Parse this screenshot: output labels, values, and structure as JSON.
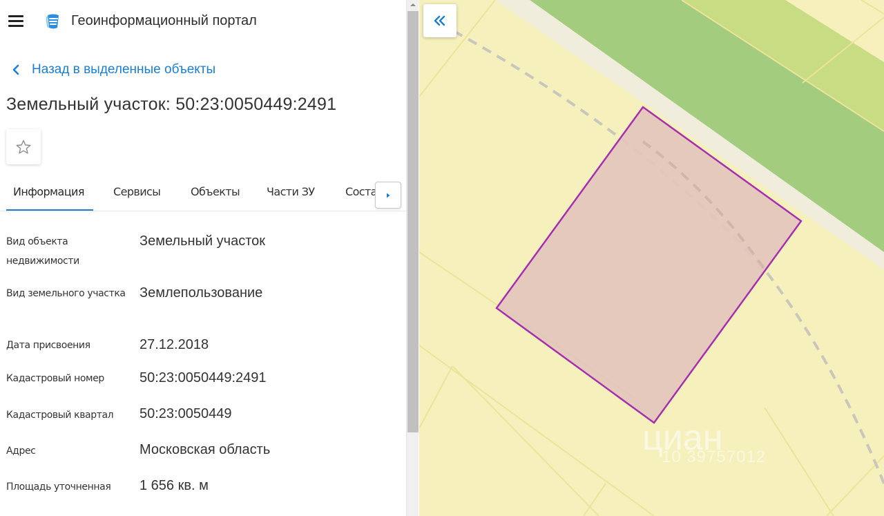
{
  "header": {
    "menu_icon": "hamburger-menu-icon",
    "logo_icon": "portal-logo-icon",
    "title": "Геоинформационный портал"
  },
  "navigation": {
    "back_label": "Назад в выделенные объекты",
    "back_icon": "chevron-left-icon"
  },
  "object": {
    "title": "Земельный участок: 50:23:0050449:2491",
    "favorite_icon": "star-outline-icon"
  },
  "tabs": [
    {
      "label": "Информация",
      "active": true
    },
    {
      "label": "Сервисы",
      "active": false
    },
    {
      "label": "Объекты",
      "active": false
    },
    {
      "label": "Части ЗУ",
      "active": false
    },
    {
      "label": "Состав ЕЗ",
      "active": false
    }
  ],
  "tabs_scroll_icon": "caret-right-icon",
  "properties": [
    {
      "label": "Вид объекта недвижимости",
      "value": "Земельный участок"
    },
    {
      "label": "Вид земельного участка",
      "value": "Землепользование"
    },
    {
      "label": "Дата присвоения",
      "value": "27.12.2018"
    },
    {
      "label": "Кадастровый номер",
      "value": "50:23:0050449:2491"
    },
    {
      "label": "Кадастровый квартал",
      "value": "50:23:0050449"
    },
    {
      "label": "Адрес",
      "value": "Московская область"
    },
    {
      "label": "Площадь уточненная",
      "value": "1 656 кв. м"
    }
  ],
  "map": {
    "collapse_icon": "double-chevron-left-icon",
    "watermark_text": "циан",
    "watermark_id": "10 39757012",
    "colors": {
      "background": "#f5f0bc",
      "green_zone": "#a3cc7e",
      "parcel_fill": "#e2c6bc",
      "parcel_stroke": "#a62fb0",
      "boundary_line": "#ece49a"
    }
  },
  "colors": {
    "accent": "#1a7fd4",
    "text": "#333333"
  }
}
